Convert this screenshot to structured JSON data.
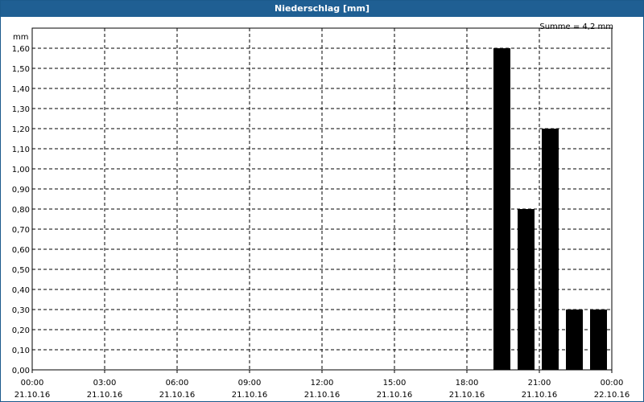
{
  "window": {
    "title": "Niederschlag [mm]"
  },
  "chart_data": {
    "type": "bar",
    "ylabel": "mm",
    "annotation": "Summe = 4,2 mm",
    "ylim": [
      0,
      1.6
    ],
    "y_ticks": [
      "0,00",
      "0,10",
      "0,20",
      "0,30",
      "0,40",
      "0,50",
      "0,60",
      "0,70",
      "0,80",
      "0,90",
      "1,00",
      "1,10",
      "1,20",
      "1,30",
      "1,40",
      "1,50",
      "1,60"
    ],
    "x_ticks": [
      {
        "time": "00:00",
        "date": "21.10.16"
      },
      {
        "time": "03:00",
        "date": "21.10.16"
      },
      {
        "time": "06:00",
        "date": "21.10.16"
      },
      {
        "time": "09:00",
        "date": "21.10.16"
      },
      {
        "time": "12:00",
        "date": "21.10.16"
      },
      {
        "time": "15:00",
        "date": "21.10.16"
      },
      {
        "time": "18:00",
        "date": "21.10.16"
      },
      {
        "time": "21:00",
        "date": "21.10.16"
      },
      {
        "time": "00:00",
        "date": "22.10.16"
      }
    ],
    "bars": [
      {
        "period": "19:00–20:00",
        "value": 1.6
      },
      {
        "period": "20:00–21:00",
        "value": 0.8
      },
      {
        "period": "21:00–22:00",
        "value": 1.2
      },
      {
        "period": "22:00–23:00",
        "value": 0.3
      },
      {
        "period": "23:00–00:00",
        "value": 0.3
      }
    ],
    "bar_color": "#000000",
    "grid": true
  }
}
